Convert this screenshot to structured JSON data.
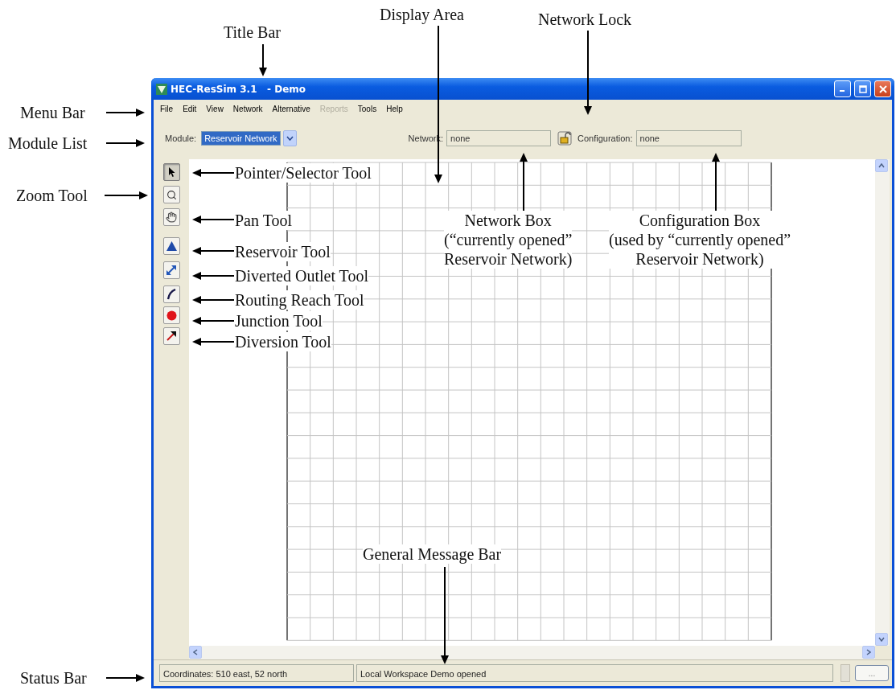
{
  "window": {
    "title": "HEC-ResSim 3.1   - Demo"
  },
  "menu": [
    {
      "label": "File",
      "disabled": false
    },
    {
      "label": "Edit",
      "disabled": false
    },
    {
      "label": "View",
      "disabled": false
    },
    {
      "label": "Network",
      "disabled": false
    },
    {
      "label": "Alternative",
      "disabled": false
    },
    {
      "label": "Reports",
      "disabled": true
    },
    {
      "label": "Tools",
      "disabled": false
    },
    {
      "label": "Help",
      "disabled": false
    }
  ],
  "module": {
    "label": "Module:",
    "value": "Reservoir Network"
  },
  "network": {
    "label": "Network:",
    "value": "none"
  },
  "configuration": {
    "label": "Configuration:",
    "value": "none"
  },
  "tools": [
    {
      "kind": "pointer",
      "selected": true
    },
    {
      "kind": "zoom",
      "selected": false
    },
    {
      "kind": "pan",
      "selected": false
    },
    {
      "kind": "reservoir",
      "selected": false
    },
    {
      "kind": "diverted-outlet",
      "selected": false
    },
    {
      "kind": "routing-reach",
      "selected": false
    },
    {
      "kind": "junction",
      "selected": false
    },
    {
      "kind": "diversion",
      "selected": false
    }
  ],
  "status_bar": {
    "coordinates": "Coordinates: 510 east, 52 north",
    "message": "Local Workspace Demo opened",
    "more_button": "..."
  },
  "callouts": [
    {
      "lines": [
        "Title Bar"
      ]
    },
    {
      "lines": [
        "Display Area"
      ]
    },
    {
      "lines": [
        "Network Lock"
      ]
    },
    {
      "lines": [
        "Menu Bar"
      ]
    },
    {
      "lines": [
        "Module List"
      ]
    },
    {
      "lines": [
        "Zoom Tool"
      ]
    },
    {
      "lines": [
        "Pointer/Selector Tool"
      ]
    },
    {
      "lines": [
        "Pan Tool"
      ]
    },
    {
      "lines": [
        "Reservoir Tool"
      ]
    },
    {
      "lines": [
        "Diverted Outlet Tool"
      ]
    },
    {
      "lines": [
        "Routing Reach Tool"
      ]
    },
    {
      "lines": [
        "Junction Tool"
      ]
    },
    {
      "lines": [
        "Diversion Tool"
      ]
    },
    {
      "lines": [
        "Network Box",
        "(“currently opened”",
        "Reservoir Network)"
      ]
    },
    {
      "lines": [
        "Configuration Box",
        "(used by “currently opened”",
        "Reservoir Network)"
      ]
    },
    {
      "lines": [
        "General Message Bar"
      ]
    },
    {
      "lines": [
        "Status Bar"
      ]
    }
  ]
}
